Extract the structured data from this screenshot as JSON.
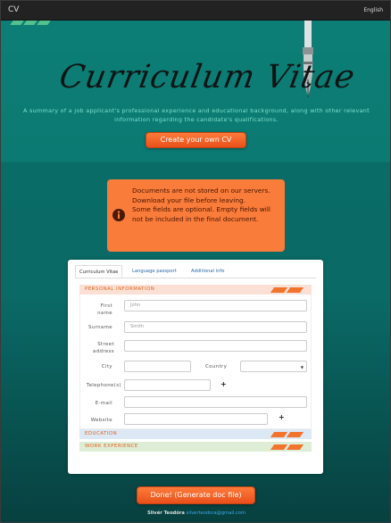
{
  "topbar": {
    "brand": "CV",
    "language": "English"
  },
  "hero": {
    "title": "Curriculum Vitae",
    "subtitle": "A summary of a job applicant's professional experience and educational background, along with other relevant information regarding the candidate's qualifications.",
    "create_button": "Create your own CV"
  },
  "notice": {
    "line1": "Documents are not stored on our servers. Download your file before leaving.",
    "line2": "Some fields are optional. Empty fields will not be included in the final document."
  },
  "tabs": [
    "Curriculum Vitae",
    "Language passport",
    "Additional info"
  ],
  "sections": {
    "personal": "PERSONAL INFORMATION",
    "education": "EDUCATION",
    "work": "WORK EXPERIENCE"
  },
  "fields": {
    "first_name": {
      "label": "First name",
      "placeholder": "John"
    },
    "surname": {
      "label": "Surname",
      "placeholder": "Smith"
    },
    "street": {
      "label": "Street address",
      "placeholder": ""
    },
    "city": {
      "label": "City",
      "placeholder": ""
    },
    "country": {
      "label": "Country",
      "value": ""
    },
    "telephone": {
      "label": "Telephone(s)",
      "placeholder": ""
    },
    "email": {
      "label": "E-mail",
      "placeholder": ""
    },
    "website": {
      "label": "Website",
      "placeholder": ""
    }
  },
  "icons": {
    "add": "+",
    "info": "i"
  },
  "done_button": "Done! (Generate doc file)",
  "footer": {
    "name": "Slivér Teodóra",
    "email": "silverteodora@gmail.com"
  },
  "colors": {
    "accent": "#f2732c",
    "teal": "#0b7a72"
  }
}
